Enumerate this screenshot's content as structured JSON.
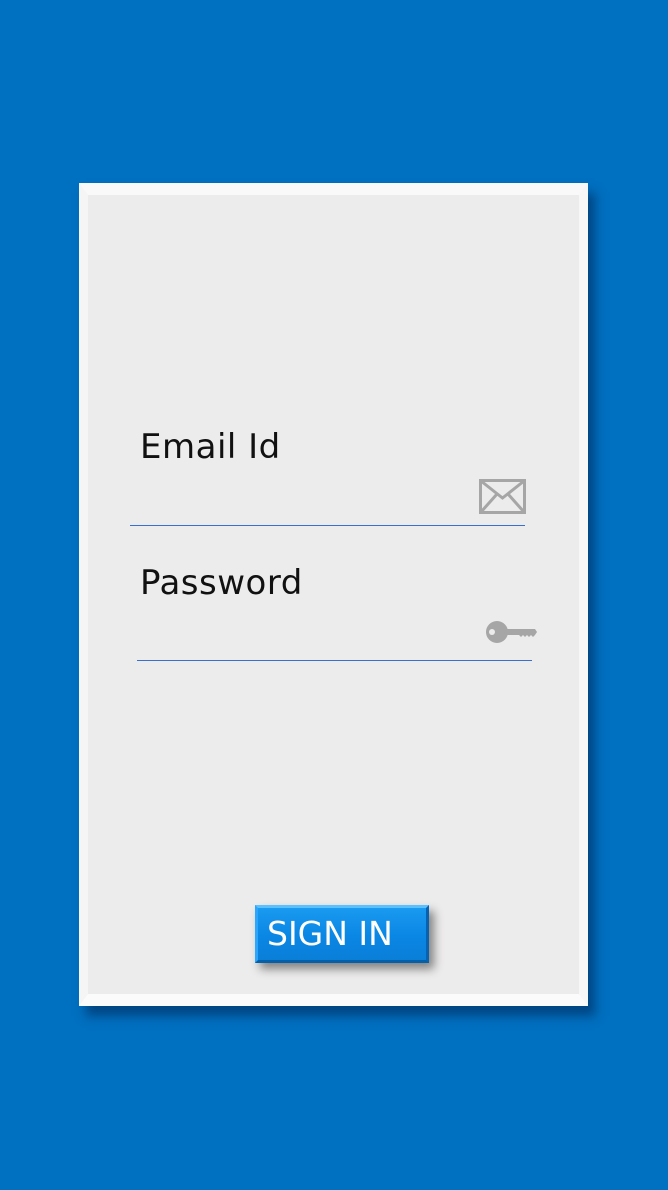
{
  "form": {
    "email_label": "Email Id",
    "password_label": "Password",
    "signin_label": "SIGN IN"
  },
  "icons": {
    "email": "envelope-icon",
    "password": "key-icon"
  },
  "colors": {
    "background": "#0070c0",
    "card": "#edecec",
    "button": "#0a86e4",
    "underline": "#3a6fd0",
    "icon": "#a6a6a6"
  }
}
